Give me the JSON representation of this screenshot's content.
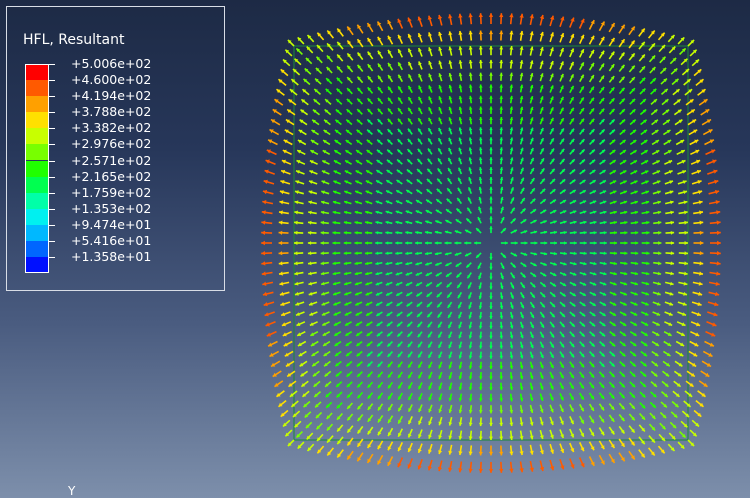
{
  "legend": {
    "title": "HFL, Resultant",
    "entries": [
      {
        "label": "+5.006e+02",
        "color": "#ff0000"
      },
      {
        "label": "+4.600e+02",
        "color": "#ff5a00"
      },
      {
        "label": "+4.194e+02",
        "color": "#ffa000"
      },
      {
        "label": "+3.788e+02",
        "color": "#ffe000"
      },
      {
        "label": "+3.382e+02",
        "color": "#c8ff00"
      },
      {
        "label": "+2.976e+02",
        "color": "#78ff00"
      },
      {
        "label": "+2.571e+02",
        "color": "#20ff00"
      },
      {
        "label": "+2.165e+02",
        "color": "#00ff50"
      },
      {
        "label": "+1.759e+02",
        "color": "#00ffa8"
      },
      {
        "label": "+1.353e+02",
        "color": "#00f0f0"
      },
      {
        "label": "+9.474e+01",
        "color": "#00b8ff"
      },
      {
        "label": "+5.416e+01",
        "color": "#0066ff"
      },
      {
        "label": "+1.358e+01",
        "color": "#0010ff"
      }
    ]
  },
  "field": {
    "grid_count": 41,
    "min_value": 13.58,
    "max_value": 500.6
  },
  "triad": {
    "label": "Y"
  }
}
